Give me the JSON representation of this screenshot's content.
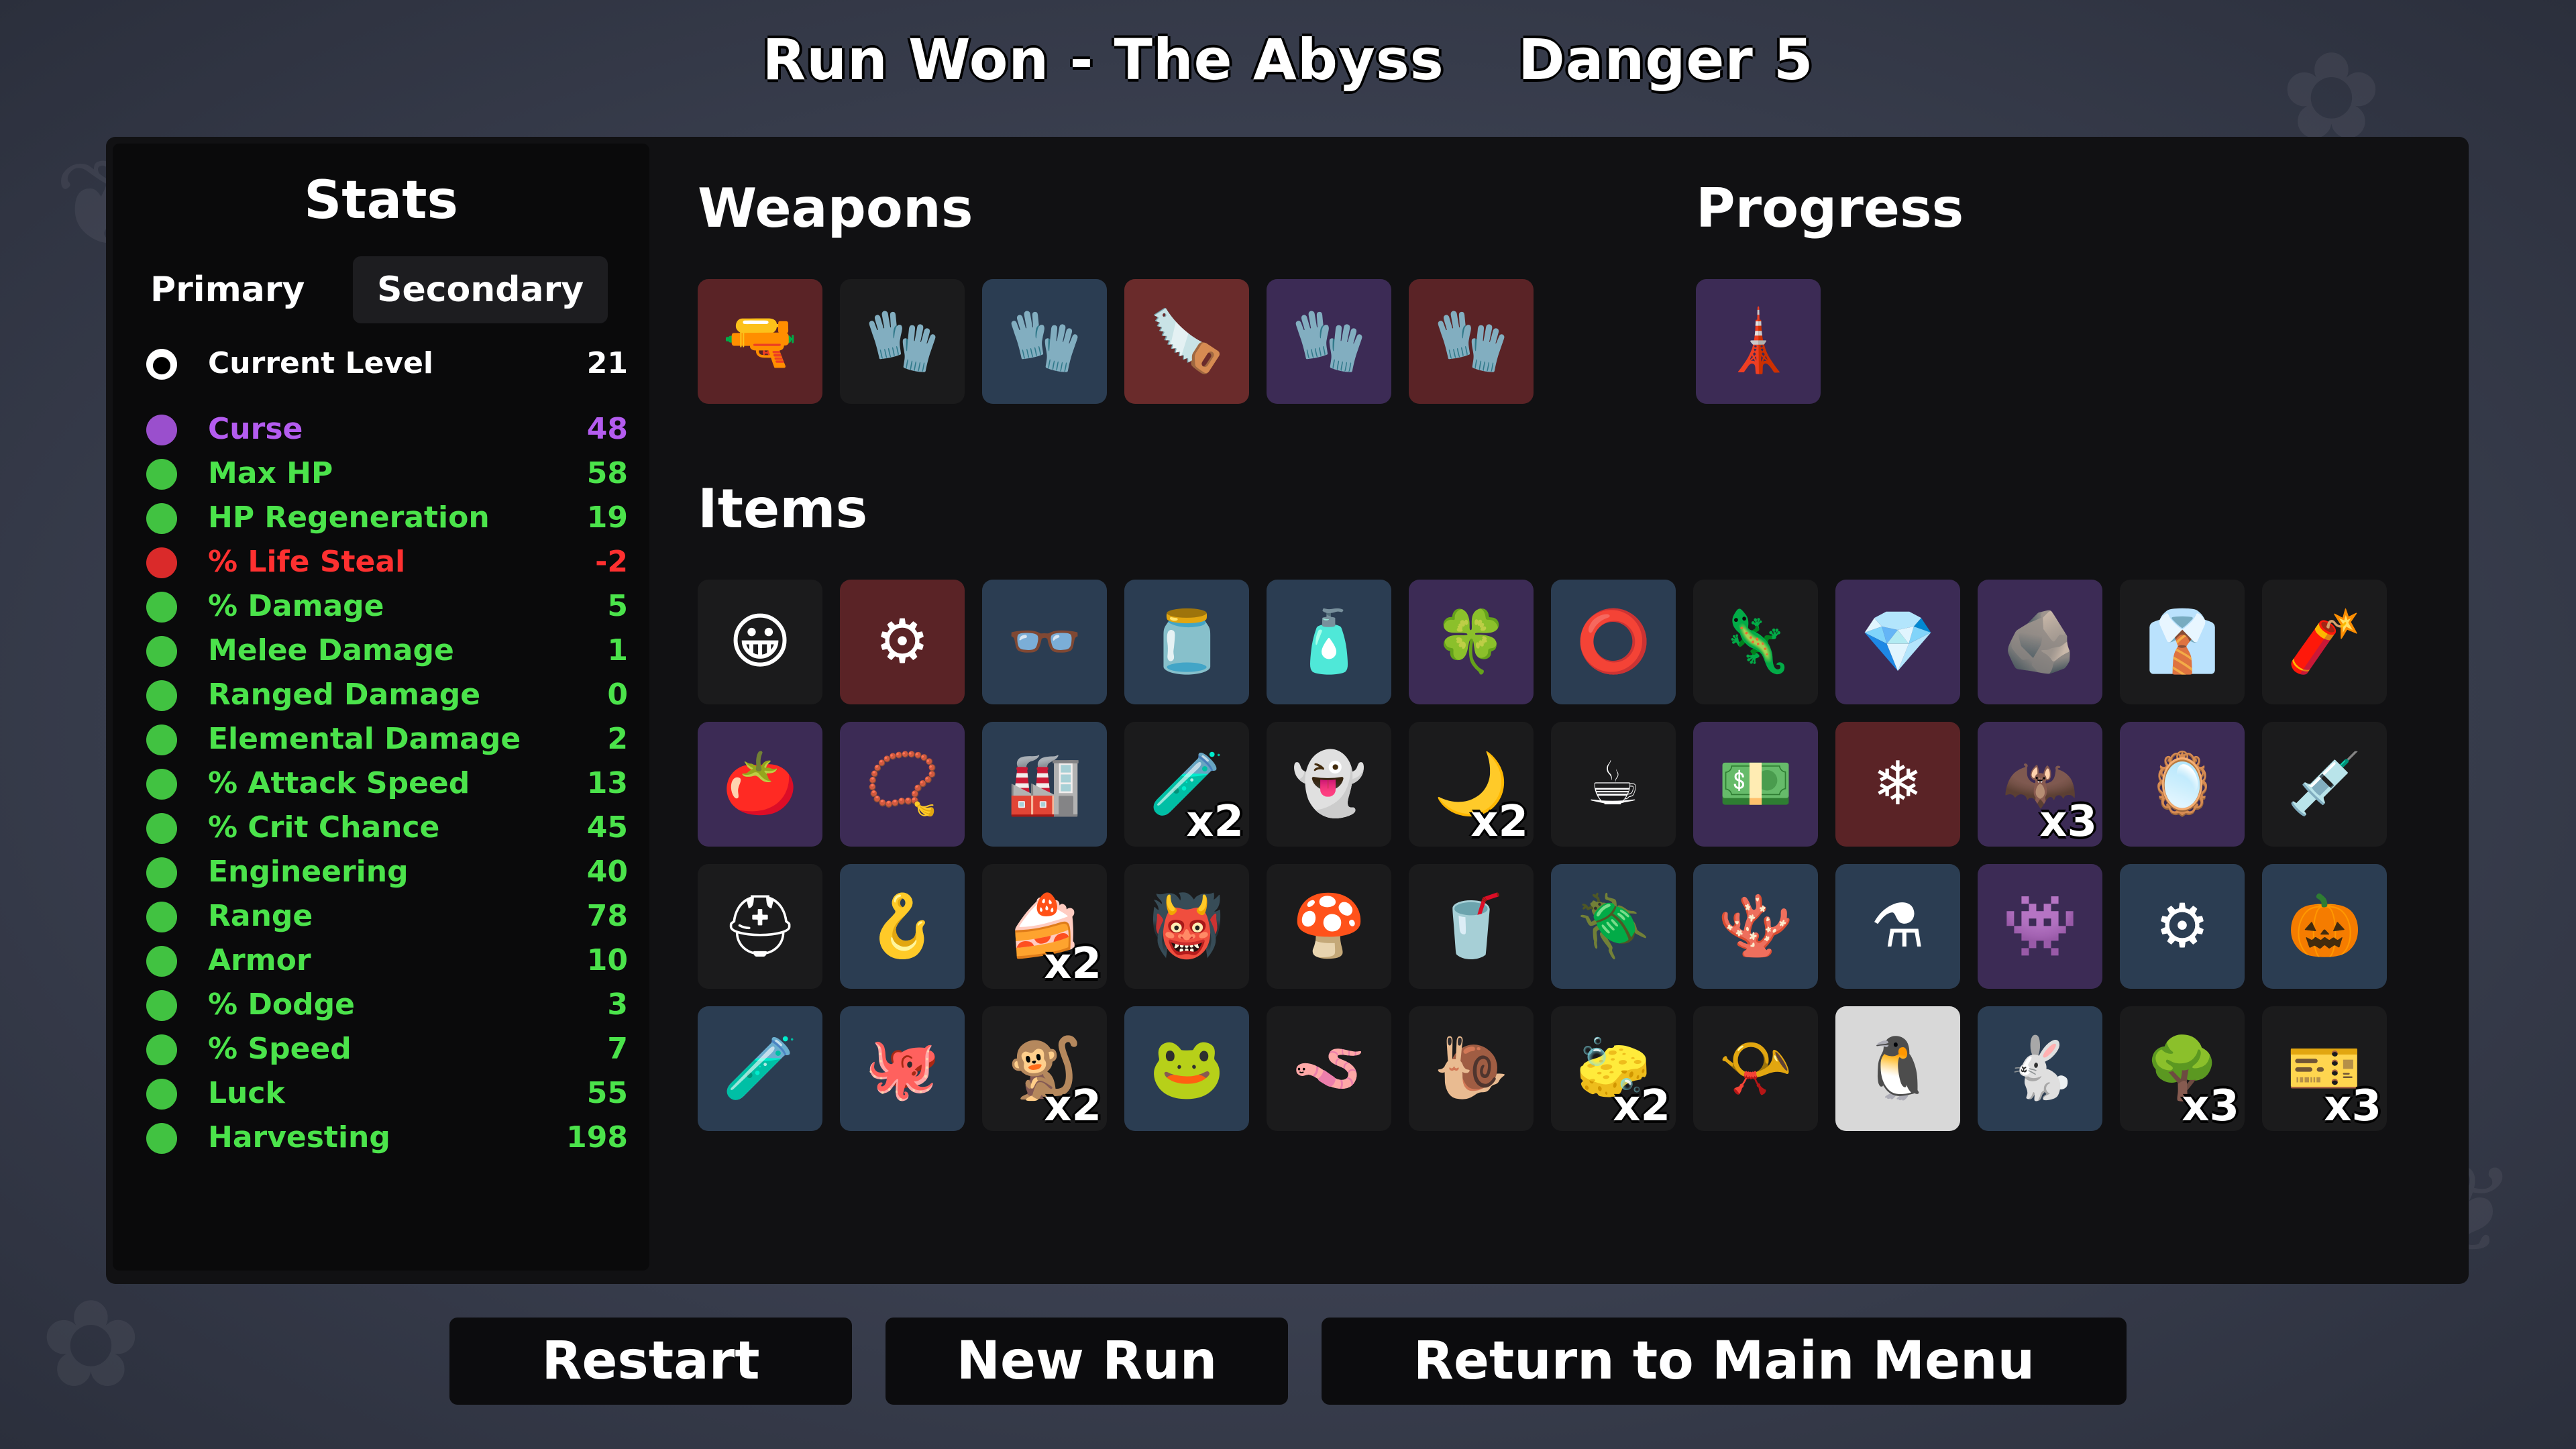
{
  "header": {
    "run_label": "Run Won - The Abyss",
    "danger_label": "Danger 5"
  },
  "stats": {
    "title": "Stats",
    "tabs": [
      {
        "label": "Primary"
      },
      {
        "label": "Secondary"
      }
    ],
    "level": {
      "label": "Current Level",
      "value": "21"
    },
    "rows": [
      {
        "label": "Curse",
        "value": "48",
        "color": "#b45cf0",
        "icon": "curse-icon"
      },
      {
        "label": "Max HP",
        "value": "58",
        "color": "#4be34b",
        "icon": "heart-icon"
      },
      {
        "label": "HP Regeneration",
        "value": "19",
        "color": "#4be34b",
        "icon": "regen-icon"
      },
      {
        "label": "% Life Steal",
        "value": "-2",
        "color": "#ff3030",
        "icon": "life-steal-icon"
      },
      {
        "label": "% Damage",
        "value": "5",
        "color": "#4be34b",
        "icon": "brain-icon"
      },
      {
        "label": "Melee Damage",
        "value": "1",
        "color": "#4be34b",
        "icon": "sword-icon"
      },
      {
        "label": "Ranged Damage",
        "value": "0",
        "color": "#4be34b",
        "icon": "bow-icon"
      },
      {
        "label": "Elemental Damage",
        "value": "2",
        "color": "#4be34b",
        "icon": "flame-icon"
      },
      {
        "label": "% Attack Speed",
        "value": "13",
        "color": "#4be34b",
        "icon": "hourglass-icon"
      },
      {
        "label": "% Crit Chance",
        "value": "45",
        "color": "#4be34b",
        "icon": "crit-icon"
      },
      {
        "label": "Engineering",
        "value": "40",
        "color": "#4be34b",
        "icon": "wrench-icon"
      },
      {
        "label": "Range",
        "value": "78",
        "color": "#4be34b",
        "icon": "range-icon"
      },
      {
        "label": "Armor",
        "value": "10",
        "color": "#4be34b",
        "icon": "shield-icon"
      },
      {
        "label": "% Dodge",
        "value": "3",
        "color": "#4be34b",
        "icon": "dodge-icon"
      },
      {
        "label": "% Speed",
        "value": "7",
        "color": "#4be34b",
        "icon": "boot-icon"
      },
      {
        "label": "Luck",
        "value": "55",
        "color": "#4be34b",
        "icon": "dice-icon"
      },
      {
        "label": "Harvesting",
        "value": "198",
        "color": "#4be34b",
        "icon": "wheat-icon"
      }
    ]
  },
  "weapons": {
    "title": "Weapons",
    "slots": [
      {
        "icon": "revolver-icon",
        "glyph": "🔫",
        "bg": "#5a2326"
      },
      {
        "icon": "gauntlet-icon",
        "glyph": "🧤",
        "bg": "#1b1b1c"
      },
      {
        "icon": "gauntlet-icon",
        "glyph": "🧤",
        "bg": "#2b3d52"
      },
      {
        "icon": "chainsaw-icon",
        "glyph": "🪚",
        "bg": "#6a2b2b"
      },
      {
        "icon": "gauntlet-icon",
        "glyph": "🧤",
        "bg": "#3c2b55"
      },
      {
        "icon": "gauntlet-icon",
        "glyph": "🧤",
        "bg": "#5a2326"
      }
    ]
  },
  "progress": {
    "title": "Progress",
    "slots": [
      {
        "icon": "lighthouse-icon",
        "glyph": "🗼",
        "bg": "#3c2b55"
      }
    ]
  },
  "items": {
    "title": "Items",
    "slots": [
      {
        "icon": "helmet-face-icon",
        "glyph": "😀",
        "bg": "#1b1b1c",
        "count": ""
      },
      {
        "icon": "turret-icon",
        "glyph": "⚙",
        "bg": "#5a2326",
        "count": ""
      },
      {
        "icon": "glasses-icon",
        "glyph": "👓",
        "bg": "#2b3d52",
        "count": ""
      },
      {
        "icon": "jar-icon",
        "glyph": "🫙",
        "bg": "#2b3d52",
        "count": ""
      },
      {
        "icon": "ketchup-icon",
        "glyph": "🧴",
        "bg": "#2b3d52",
        "count": ""
      },
      {
        "icon": "clover-icon",
        "glyph": "🍀",
        "bg": "#3c2b55",
        "count": ""
      },
      {
        "icon": "ring-icon",
        "glyph": "⭕",
        "bg": "#2b3d52",
        "count": ""
      },
      {
        "icon": "lizard-icon",
        "glyph": "🦎",
        "bg": "#1b1b1c",
        "count": ""
      },
      {
        "icon": "crystal-icon",
        "glyph": "💎",
        "bg": "#3c2b55",
        "count": ""
      },
      {
        "icon": "rock-icon",
        "glyph": "🪨",
        "bg": "#3c2b55",
        "count": ""
      },
      {
        "icon": "shirt-icon",
        "glyph": "👔",
        "bg": "#1b1b1c",
        "count": ""
      },
      {
        "icon": "dynamite-icon",
        "glyph": "🧨",
        "bg": "#1b1b1c",
        "count": ""
      },
      {
        "icon": "tomato-icon",
        "glyph": "🍅",
        "bg": "#3c2b55",
        "count": ""
      },
      {
        "icon": "bracelet-icon",
        "glyph": "📿",
        "bg": "#3c2b55",
        "count": ""
      },
      {
        "icon": "machine-icon",
        "glyph": "🏭",
        "bg": "#2b3d52",
        "count": ""
      },
      {
        "icon": "slime-icon",
        "glyph": "🧪",
        "bg": "#1b1b1c",
        "count": "x2"
      },
      {
        "icon": "ghost-icon",
        "glyph": "👻",
        "bg": "#1b1b1c",
        "count": ""
      },
      {
        "icon": "hook-blade-icon",
        "glyph": "🌙",
        "bg": "#1b1b1c",
        "count": "x2"
      },
      {
        "icon": "mug-icon",
        "glyph": "☕",
        "bg": "#1b1b1c",
        "count": ""
      },
      {
        "icon": "cash-icon",
        "glyph": "💵",
        "bg": "#3c2b55",
        "count": ""
      },
      {
        "icon": "snow-orb-icon",
        "glyph": "❄",
        "bg": "#5a2326",
        "count": ""
      },
      {
        "icon": "bat-icon",
        "glyph": "🦇",
        "bg": "#3c2b55",
        "count": "x3"
      },
      {
        "icon": "mirror-icon",
        "glyph": "🪞",
        "bg": "#3c2b55",
        "count": ""
      },
      {
        "icon": "syringe-icon",
        "glyph": "💉",
        "bg": "#1b1b1c",
        "count": ""
      },
      {
        "icon": "helmet-icon",
        "glyph": "⛑",
        "bg": "#1b1b1c",
        "count": ""
      },
      {
        "icon": "fishhook-icon",
        "glyph": "🪝",
        "bg": "#2b3d52",
        "count": ""
      },
      {
        "icon": "cake-icon",
        "glyph": "🍰",
        "bg": "#1b1b1c",
        "count": "x2"
      },
      {
        "icon": "mask-icon",
        "glyph": "👹",
        "bg": "#1b1b1c",
        "count": ""
      },
      {
        "icon": "mushroom-icon",
        "glyph": "🍄",
        "bg": "#1b1b1c",
        "count": ""
      },
      {
        "icon": "cup-icon",
        "glyph": "🥤",
        "bg": "#1b1b1c",
        "count": ""
      },
      {
        "icon": "bug-icon",
        "glyph": "🪲",
        "bg": "#2b3d52",
        "count": ""
      },
      {
        "icon": "coral-icon",
        "glyph": "🪸",
        "bg": "#2b3d52",
        "count": ""
      },
      {
        "icon": "flask-icon",
        "glyph": "⚗",
        "bg": "#2b3d52",
        "count": ""
      },
      {
        "icon": "blob-icon",
        "glyph": "👾",
        "bg": "#3c2b55",
        "count": ""
      },
      {
        "icon": "gear-icon",
        "glyph": "⚙",
        "bg": "#2b3d52",
        "count": ""
      },
      {
        "icon": "pumpkin-icon",
        "glyph": "🎃",
        "bg": "#2b3d52",
        "count": ""
      },
      {
        "icon": "potion-icon",
        "glyph": "🧪",
        "bg": "#2b3d52",
        "count": ""
      },
      {
        "icon": "tentacle-icon",
        "glyph": "🐙",
        "bg": "#2b3d52",
        "count": ""
      },
      {
        "icon": "monkey-icon",
        "glyph": "🐒",
        "bg": "#1b1b1c",
        "count": "x2"
      },
      {
        "icon": "frog-icon",
        "glyph": "🐸",
        "bg": "#2b3d52",
        "count": ""
      },
      {
        "icon": "worm-icon",
        "glyph": "🪱",
        "bg": "#1b1b1c",
        "count": ""
      },
      {
        "icon": "snail-icon",
        "glyph": "🐌",
        "bg": "#1b1b1c",
        "count": ""
      },
      {
        "icon": "eraser-icon",
        "glyph": "🧽",
        "bg": "#1b1b1c",
        "count": "x2"
      },
      {
        "icon": "whistle-icon",
        "glyph": "📯",
        "bg": "#1b1b1c",
        "count": ""
      },
      {
        "icon": "penguin-icon",
        "glyph": "🐧",
        "bg": "#d8d8d8",
        "count": ""
      },
      {
        "icon": "rabbit-icon",
        "glyph": "🐇",
        "bg": "#2b3d52",
        "count": ""
      },
      {
        "icon": "tree-icon",
        "glyph": "🌳",
        "bg": "#1b1b1c",
        "count": "x3"
      },
      {
        "icon": "ticket-icon",
        "glyph": "🎫",
        "bg": "#1b1b1c",
        "count": "x3"
      }
    ]
  },
  "buttons": {
    "restart": "Restart",
    "new_run": "New Run",
    "main_menu": "Return to Main Menu"
  }
}
